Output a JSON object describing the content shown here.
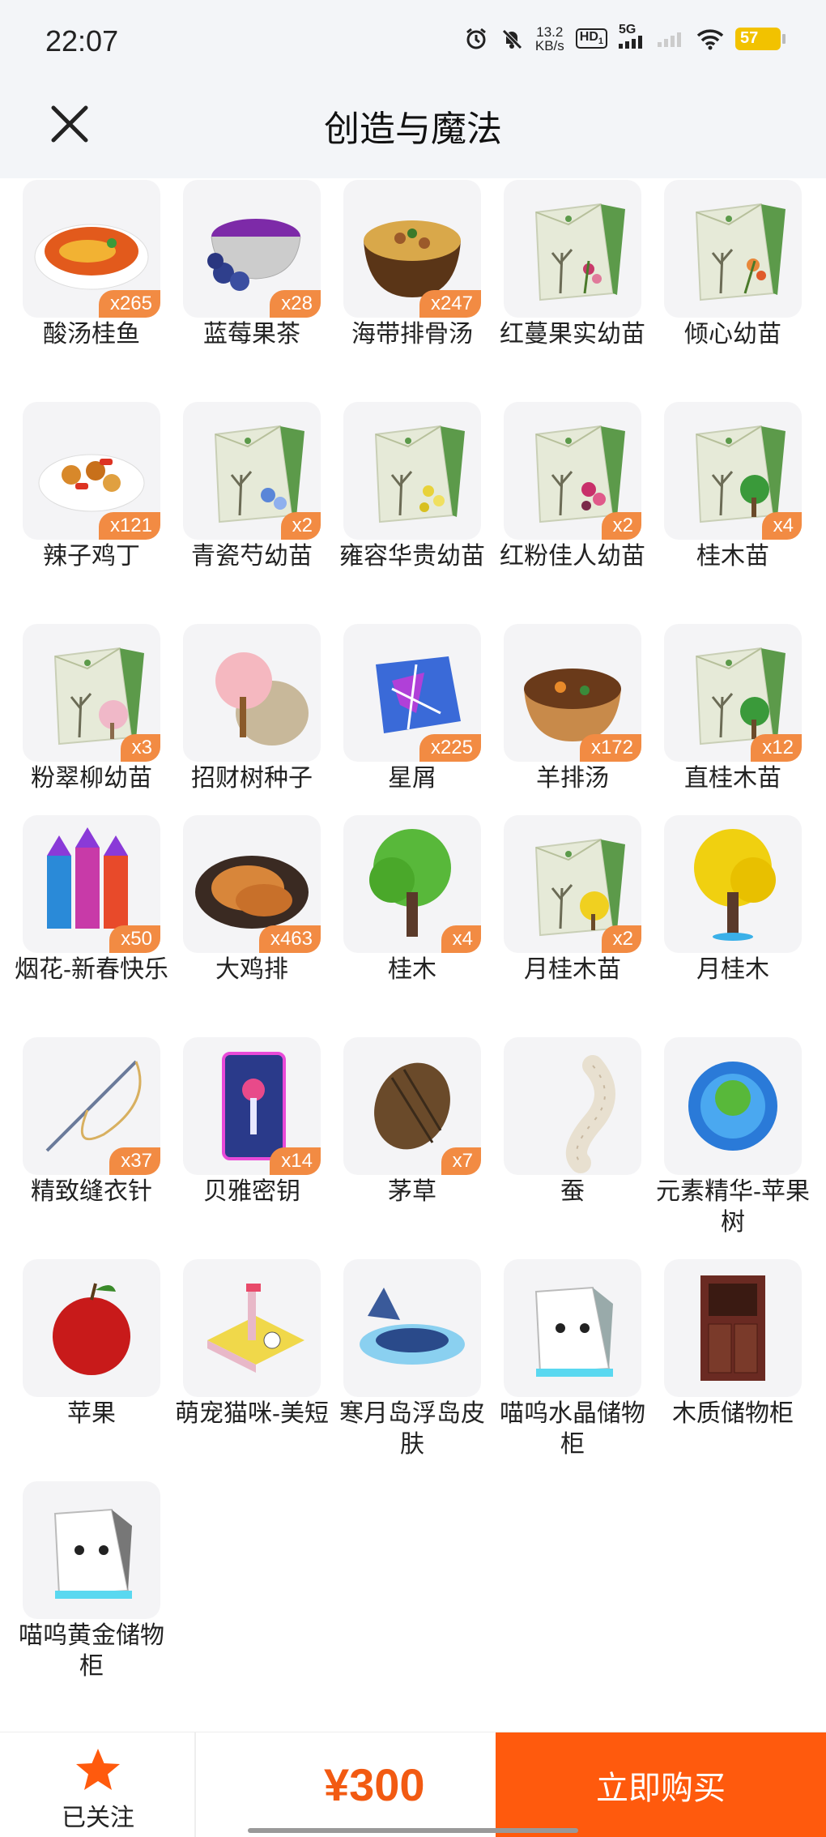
{
  "status_bar": {
    "time": "22:07",
    "net_speed_value": "13.2",
    "net_speed_unit": "KB/s",
    "hd": "HD",
    "hd_sub": "1",
    "network": "5G",
    "battery": "57",
    "icons": [
      "alarm-icon",
      "mute-icon",
      "signal-icon",
      "wifi-icon",
      "battery-icon"
    ]
  },
  "header": {
    "title": "创造与魔法",
    "close_icon": "close-icon"
  },
  "items": [
    {
      "name": "酸汤桂鱼",
      "count": "x265",
      "icon": "fish-soup"
    },
    {
      "name": "蓝莓果茶",
      "count": "x28",
      "icon": "blueberry-tea"
    },
    {
      "name": "海带排骨汤",
      "count": "x247",
      "icon": "rib-soup"
    },
    {
      "name": "红蔓果实幼苗",
      "count": "",
      "icon": "seed-pack-red"
    },
    {
      "name": "倾心幼苗",
      "count": "",
      "icon": "seed-pack-orange"
    },
    {
      "name": "辣子鸡丁",
      "count": "x121",
      "icon": "spicy-chicken"
    },
    {
      "name": "青瓷芍幼苗",
      "count": "x2",
      "icon": "seed-pack-blue"
    },
    {
      "name": "雍容华贵幼苗",
      "count": "",
      "icon": "seed-pack-yellow"
    },
    {
      "name": "红粉佳人幼苗",
      "count": "x2",
      "icon": "seed-pack-pink"
    },
    {
      "name": "桂木苗",
      "count": "x4",
      "icon": "seed-pack-tree"
    },
    {
      "name": "粉翠柳幼苗",
      "count": "x3",
      "icon": "seed-pack-willow"
    },
    {
      "name": "招财树种子",
      "count": "",
      "icon": "fortune-tree-seed"
    },
    {
      "name": "星屑",
      "count": "x225",
      "icon": "stardust"
    },
    {
      "name": "羊排汤",
      "count": "x172",
      "icon": "lamb-soup"
    },
    {
      "name": "直桂木苗",
      "count": "x12",
      "icon": "seed-pack-tree"
    },
    {
      "name": "烟花-新春快乐",
      "count": "x50",
      "icon": "fireworks"
    },
    {
      "name": "大鸡排",
      "count": "x463",
      "icon": "chicken-cutlet"
    },
    {
      "name": "桂木",
      "count": "x4",
      "icon": "green-tree"
    },
    {
      "name": "月桂木苗",
      "count": "x2",
      "icon": "seed-pack-gold"
    },
    {
      "name": "月桂木",
      "count": "",
      "icon": "golden-tree"
    },
    {
      "name": "精致缝衣针",
      "count": "x37",
      "icon": "needle"
    },
    {
      "name": "贝雅密钥",
      "count": "x14",
      "icon": "key-card"
    },
    {
      "name": "茅草",
      "count": "x7",
      "icon": "thatch"
    },
    {
      "name": "蚕",
      "count": "",
      "icon": "silkworm"
    },
    {
      "name": "元素精华-苹果树",
      "count": "",
      "icon": "essence-orb"
    },
    {
      "name": "苹果",
      "count": "",
      "icon": "apple"
    },
    {
      "name": "萌宠猫咪-美短",
      "count": "",
      "icon": "cat-pet"
    },
    {
      "name": "寒月岛浮岛皮肤",
      "count": "",
      "icon": "floating-island"
    },
    {
      "name": "喵呜水晶储物柜",
      "count": "",
      "icon": "cat-cabinet-crystal"
    },
    {
      "name": "木质储物柜",
      "count": "",
      "icon": "wood-cabinet"
    },
    {
      "name": "喵呜黄金储物柜",
      "count": "",
      "icon": "cat-cabinet-gold"
    }
  ],
  "bottom_bar": {
    "follow_label": "已关注",
    "follow_icon": "star-icon",
    "price": "¥300",
    "buy_label": "立即购买"
  },
  "colors": {
    "accent": "#ff5a0d",
    "price": "#f25a12",
    "badge": "#f28b43",
    "star": "#ff5a0d"
  }
}
